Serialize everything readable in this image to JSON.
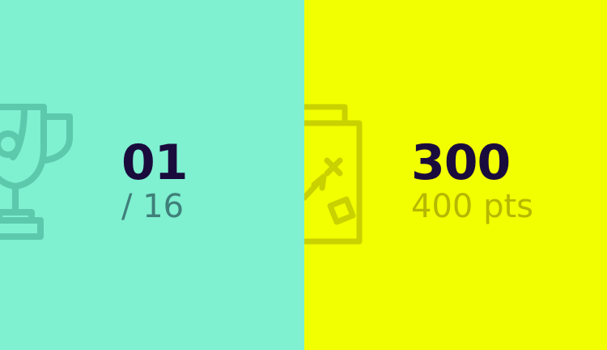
{
  "colors": {
    "left_background": "#7ff0d0",
    "right_background": "#f2ff00",
    "value_text": "#1a0b3d",
    "left_subtext": "#3f7f7a",
    "right_subtext": "#b5b800",
    "left_icon": "#5cc9ad",
    "right_icon": "#c9d100"
  },
  "left_panel": {
    "icon": "trophy-icon",
    "rank": "01",
    "total": "/ 16"
  },
  "right_panel": {
    "icon": "game-plan-clipboard-icon",
    "score": "300",
    "max": "400 pts"
  }
}
